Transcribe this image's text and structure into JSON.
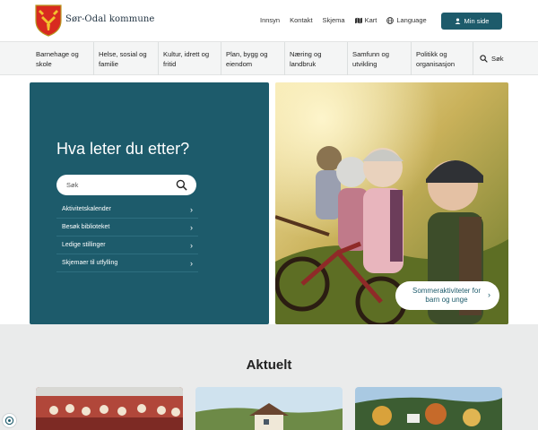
{
  "header": {
    "site_name": "Sør-Odal kommune",
    "links": [
      "Innsyn",
      "Kontakt",
      "Skjema",
      "Kart",
      "Language"
    ],
    "min_side": "Min side"
  },
  "nav": {
    "items": [
      "Barnehage og skole",
      "Helse, sosial og familie",
      "Kultur, idrett og fritid",
      "Plan, bygg og eiendom",
      "Næring og landbruk",
      "Samfunn og utvikling",
      "Politikk og organisasjon"
    ],
    "search": "Søk"
  },
  "hero": {
    "title": "Hva leter du etter?",
    "search_placeholder": "Søk",
    "quick_links": [
      "Aktivitetskalender",
      "Besøk biblioteket",
      "Ledige stillinger",
      "Skjemaer til utfylling"
    ],
    "cta": "Sommeraktiviteter for barn og unge"
  },
  "aktuelt": {
    "title": "Aktuelt"
  },
  "colors": {
    "brand": "#1d5b6b",
    "nav_bg": "#f4f5f5",
    "section_bg": "#eaebeb"
  }
}
